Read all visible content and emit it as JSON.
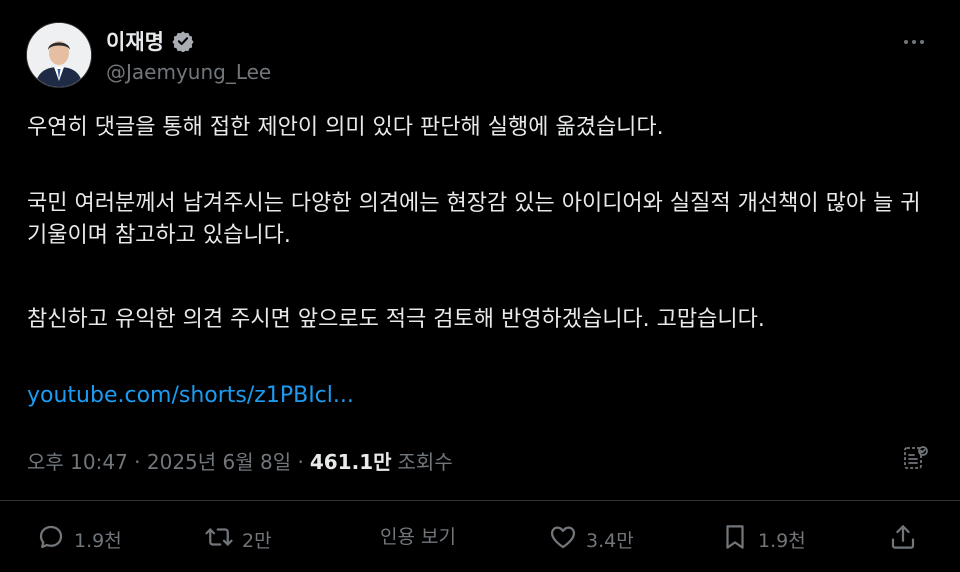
{
  "author": {
    "display_name": "이재명",
    "handle": "@Jaemyung_Lee",
    "verified": true
  },
  "post": {
    "paragraph_1": "우연히 댓글을 통해 접한 제안이 의미 있다 판단해 실행에 옮겼습니다.",
    "paragraph_2": "국민 여러분께서 남겨주시는 다양한 의견에는 현장감 있는 아이디어와 실질적 개선책이 많아 늘 귀 기울이며 참고하고 있습니다.",
    "paragraph_3": "참신하고 유익한 의견 주시면 앞으로도 적극 검토해 반영하겠습니다. 고맙습니다.",
    "link_text": "youtube.com/shorts/z1PBIcl..."
  },
  "meta": {
    "timestamp": "오후 10:47 · 2025년 6월 8일 · ",
    "views_count": "461.1만",
    "views_label": "조회수"
  },
  "actions": {
    "reply_count": "1.9천",
    "retweet_count": "2만",
    "quote_label": "인용 보기",
    "like_count": "3.4만",
    "bookmark_count": "1.9천"
  },
  "icons": {
    "more": "more-icon",
    "analytics": "analytics-icon",
    "reply": "reply-icon",
    "retweet": "retweet-icon",
    "like": "heart-icon",
    "bookmark": "bookmark-icon",
    "share": "share-icon",
    "verified": "verified-badge-icon"
  },
  "colors": {
    "background": "#000000",
    "text": "#e7e9ea",
    "muted": "#71767b",
    "link": "#1d9bf0"
  }
}
